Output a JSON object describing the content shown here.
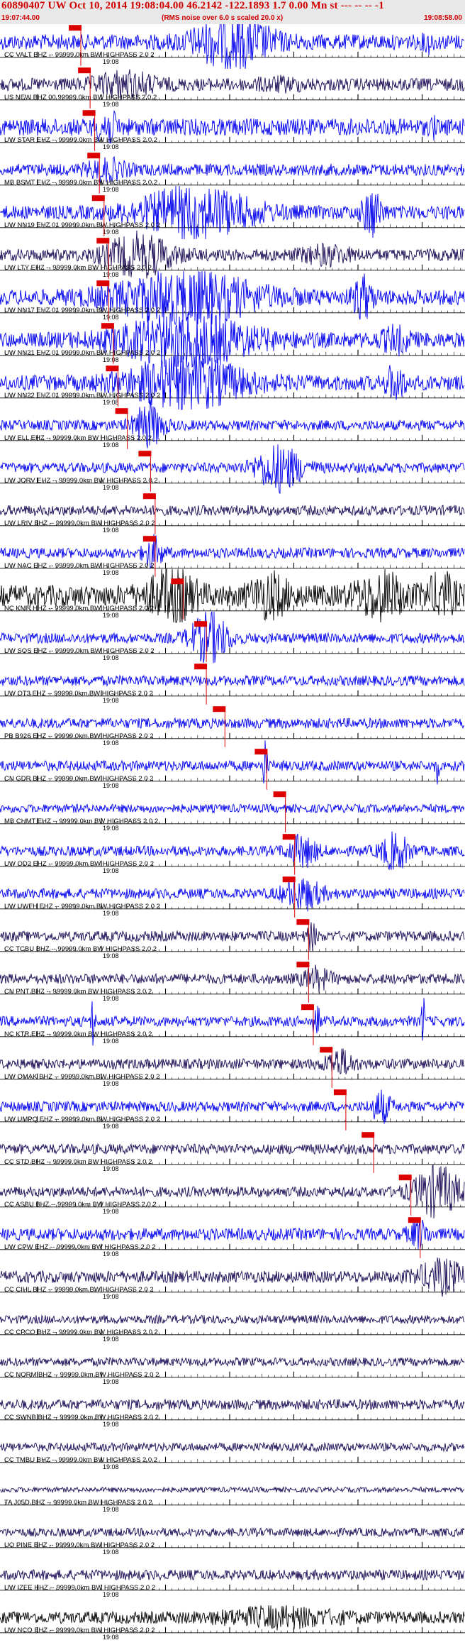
{
  "header": {
    "title": "60890407 UW Oct 10, 2014 19:08:04.00   46.2142 -122.1893  1.7 0.00 Mn st --- -- --  -1",
    "start_time": "19:07:44.00",
    "rms_note": "(RMS noise over 6.0 s scaled 20.0 x)",
    "end_time": "19:08:58.00"
  },
  "tick_label": "19:08",
  "colors": {
    "header_text": "#d00000",
    "header_bg": "#e8e8e8",
    "pick_marker": "#dd0000",
    "trace_blue": "#0000ee",
    "trace_dark": "#1a0a55",
    "trace_black": "#000000"
  },
  "traces": [
    {
      "label": "CC VALT BHZ -- 99999.0km BW  HIGHPASS  2.0  2",
      "color": "blue",
      "amp": 0.18,
      "pick": 0.16,
      "bursts": [
        [
          0.5,
          0.08,
          1.0
        ],
        [
          0.92,
          0.01,
          0.3
        ]
      ]
    },
    {
      "label": "US NEW BHZ 00 99999.0km BW  HIGHPASS  2.0  2",
      "color": "dark",
      "amp": 0.15,
      "pick": 0.18,
      "bursts": [
        [
          0.27,
          0.06,
          0.45
        ],
        [
          0.6,
          0.05,
          0.15
        ]
      ]
    },
    {
      "label": "UW STAR EHZ -- 99999.0km BW  HIGHPASS  2.0  2",
      "color": "blue",
      "amp": 0.2,
      "pick": 0.19,
      "bursts": [
        [
          0.23,
          0.02,
          0.6
        ],
        [
          0.93,
          0.005,
          0.4
        ]
      ]
    },
    {
      "label": "MB BSMT EHZ -- 99999.0km BW  HIGHPASS  2.0  2",
      "color": "blue",
      "amp": 0.14,
      "pick": 0.2,
      "bursts": [
        [
          0.23,
          0.04,
          0.35
        ]
      ]
    },
    {
      "label": "UW NN19 EHZ 01 99999.0km BW  HIGHPASS  2.0  2",
      "color": "blue",
      "amp": 0.16,
      "pick": 0.21,
      "bursts": [
        [
          0.42,
          0.12,
          1.0
        ],
        [
          0.8,
          0.02,
          0.9
        ]
      ]
    },
    {
      "label": "UW LTY EHZ -- 99999.0km BW  HIGHPASS  2.0  2",
      "color": "dark",
      "amp": 0.14,
      "pick": 0.22,
      "bursts": [
        [
          0.3,
          0.07,
          0.8
        ],
        [
          0.7,
          0.05,
          0.3
        ]
      ]
    },
    {
      "label": "UW NN17 EHZ 01 99999.0km BW  HIGHPASS  2.0  2",
      "color": "blue",
      "amp": 0.18,
      "pick": 0.22,
      "bursts": [
        [
          0.4,
          0.15,
          1.0
        ],
        [
          0.78,
          0.02,
          0.8
        ]
      ]
    },
    {
      "label": "UW NN21 EHZ 01 99999.0km BW  HIGHPASS  2.0  2",
      "color": "blue",
      "amp": 0.18,
      "pick": 0.23,
      "bursts": [
        [
          0.4,
          0.14,
          1.0
        ],
        [
          0.85,
          0.03,
          0.4
        ]
      ]
    },
    {
      "label": "UW NN22 EHZ 01 99999.0km BW  HIGHPASS  2.0  2",
      "color": "blue",
      "amp": 0.18,
      "pick": 0.24,
      "bursts": [
        [
          0.4,
          0.12,
          1.0
        ],
        [
          0.85,
          0.02,
          0.6
        ]
      ]
    },
    {
      "label": "UW ELL EHZ -- 99999.0km BW  HIGHPASS  2.0  2",
      "color": "blue",
      "amp": 0.12,
      "pick": 0.26,
      "bursts": [
        [
          0.32,
          0.03,
          0.9
        ]
      ]
    },
    {
      "label": "UW JORV EHZ -- 99999.0km BW  HIGHPASS  2.0  2",
      "color": "blue",
      "amp": 0.12,
      "pick": 0.31,
      "bursts": [
        [
          0.6,
          0.05,
          0.9
        ]
      ]
    },
    {
      "label": "UW LRIV BHZ -- 99999.0km BW  HIGHPASS  2.0  2",
      "color": "dark",
      "amp": 0.12,
      "pick": 0.32,
      "bursts": []
    },
    {
      "label": "UW NAC EHZ -- 99999.0km BW  HIGHPASS  2.0  2",
      "color": "blue",
      "amp": 0.12,
      "pick": 0.32,
      "bursts": [
        [
          0.33,
          0.02,
          0.6
        ]
      ]
    },
    {
      "label": "NC KMR HHZ -- 99999.0km BW  HIGHPASS  2.0  2",
      "color": "black",
      "amp": 0.25,
      "pick": 0.38,
      "bursts": [
        [
          0.37,
          0.05,
          0.9
        ],
        [
          0.58,
          0.04,
          0.7
        ],
        [
          0.82,
          0.05,
          0.8
        ],
        [
          0.95,
          0.03,
          0.7
        ]
      ]
    },
    {
      "label": "UW SOS EHZ -- 99999.0km BW  HIGHPASS  2.0  2",
      "color": "blue",
      "amp": 0.12,
      "pick": 0.43,
      "bursts": [
        [
          0.45,
          0.04,
          1.0
        ]
      ]
    },
    {
      "label": "UW OT3 EHZ -- 99999.0km BW  HIGHPASS  2.0  2",
      "color": "blue",
      "amp": 0.12,
      "pick": 0.43,
      "bursts": []
    },
    {
      "label": "PB B926 EHZ -- 99999.0km BW  HIGHPASS  2.0  2",
      "color": "blue",
      "amp": 0.12,
      "pick": 0.47,
      "bursts": []
    },
    {
      "label": "CN GDR BHZ -- 99999.0km BW  HIGHPASS  2.0  2",
      "color": "blue",
      "amp": 0.12,
      "pick": 0.56,
      "bursts": [
        [
          0.57,
          0.005,
          1.0
        ],
        [
          0.94,
          0.004,
          0.6
        ]
      ]
    },
    {
      "label": "MB CHMT EHZ -- 99999.0km BW  HIGHPASS  2.0  2",
      "color": "blue",
      "amp": 0.1,
      "pick": 0.6,
      "bursts": []
    },
    {
      "label": "UW OD2 EHZ -- 99999.0km BW  HIGHPASS  2.0  2",
      "color": "blue",
      "amp": 0.12,
      "pick": 0.62,
      "bursts": [
        [
          0.65,
          0.03,
          0.6
        ],
        [
          0.85,
          0.03,
          0.7
        ]
      ]
    },
    {
      "label": "UW UWFH EHZ -- 99999.0km BW  HIGHPASS  2.0  2",
      "color": "blue",
      "amp": 0.12,
      "pick": 0.62,
      "bursts": [
        [
          0.65,
          0.04,
          0.6
        ]
      ]
    },
    {
      "label": "CC TCBU BHZ -- 99999.0km BW  HIGHPASS  2.0  2",
      "color": "dark",
      "amp": 0.12,
      "pick": 0.65,
      "bursts": [
        [
          0.67,
          0.01,
          0.5
        ]
      ]
    },
    {
      "label": "CN PNT BHZ -- 99999.0km BW  HIGHPASS  2.0  2",
      "color": "dark",
      "amp": 0.12,
      "pick": 0.65,
      "bursts": [
        [
          0.68,
          0.03,
          0.4
        ]
      ]
    },
    {
      "label": "NC KTR EHZ -- 99999.0km BW  HIGHPASS  2.0  2",
      "color": "blue",
      "amp": 0.12,
      "pick": 0.66,
      "bursts": [
        [
          0.2,
          0.004,
          1.0
        ],
        [
          0.68,
          0.006,
          1.0
        ],
        [
          0.91,
          0.004,
          1.0
        ]
      ]
    },
    {
      "label": "UW OMAK BHZ -- 99999.0km BW  HIGHPASS  2.0  2",
      "color": "dark",
      "amp": 0.12,
      "pick": 0.7,
      "bursts": [
        [
          0.73,
          0.03,
          0.5
        ]
      ]
    },
    {
      "label": "UW UMPQ EHZ -- 99999.0km BW  HIGHPASS  2.0  2",
      "color": "blue",
      "amp": 0.12,
      "pick": 0.73,
      "bursts": [
        [
          0.82,
          0.02,
          0.6
        ]
      ]
    },
    {
      "label": "CC STD BHZ -- 99999.0km BW  HIGHPASS  2.0  2",
      "color": "dark",
      "amp": 0.12,
      "pick": 0.79,
      "bursts": []
    },
    {
      "label": "CC ASBU BHZ -- 99999.0km BW  HIGHPASS  2.0  2",
      "color": "dark",
      "amp": 0.12,
      "pick": 0.87,
      "bursts": [
        [
          0.94,
          0.05,
          1.0
        ]
      ]
    },
    {
      "label": "UW CPW EHZ -- 99999.0km BW  HIGHPASS  2.0  2",
      "color": "blue",
      "amp": 0.14,
      "pick": 0.89,
      "bursts": [
        [
          0.9,
          0.02,
          0.5
        ]
      ]
    },
    {
      "label": "CC CIHL BHZ -- 99999.0km BW  HIGHPASS  2.0  2",
      "color": "dark",
      "amp": 0.14,
      "pick": null,
      "bursts": [
        [
          0.95,
          0.05,
          0.6
        ]
      ]
    },
    {
      "label": "CC CPCO BHZ -- 99999.0km BW  HIGHPASS  2.0  2",
      "color": "dark",
      "amp": 0.1,
      "pick": null,
      "bursts": []
    },
    {
      "label": "CC NORM BHZ -- 99999.0km BW  HIGHPASS  2.0  2",
      "color": "dark",
      "amp": 0.1,
      "pick": null,
      "bursts": []
    },
    {
      "label": "CC SWNB BHZ -- 99999.0km BW  HIGHPASS  2.0  2",
      "color": "dark",
      "amp": 0.12,
      "pick": null,
      "bursts": []
    },
    {
      "label": "CC TMBU BHZ -- 99999.0km BW  HIGHPASS  2.0  2",
      "color": "dark",
      "amp": 0.1,
      "pick": null,
      "bursts": []
    },
    {
      "label": "TA J05D BHZ -- 99999.0km BW  HIGHPASS  2.0  2",
      "color": "dark",
      "amp": 0.06,
      "pick": null,
      "bursts": []
    },
    {
      "label": "UO PINE BHZ -- 99999.0km BW  HIGHPASS  2.0  2",
      "color": "dark",
      "amp": 0.1,
      "pick": null,
      "bursts": []
    },
    {
      "label": "UW IZEE HHZ -- 99999.0km BW  HIGHPASS  2.0  2",
      "color": "dark",
      "amp": 0.12,
      "pick": null,
      "bursts": []
    },
    {
      "label": "UW NCO EHZ -- 99999.0km BW  HIGHPASS  2.0  2",
      "color": "black",
      "amp": 0.14,
      "pick": null,
      "bursts": [
        [
          0.6,
          0.12,
          0.3
        ]
      ]
    }
  ]
}
